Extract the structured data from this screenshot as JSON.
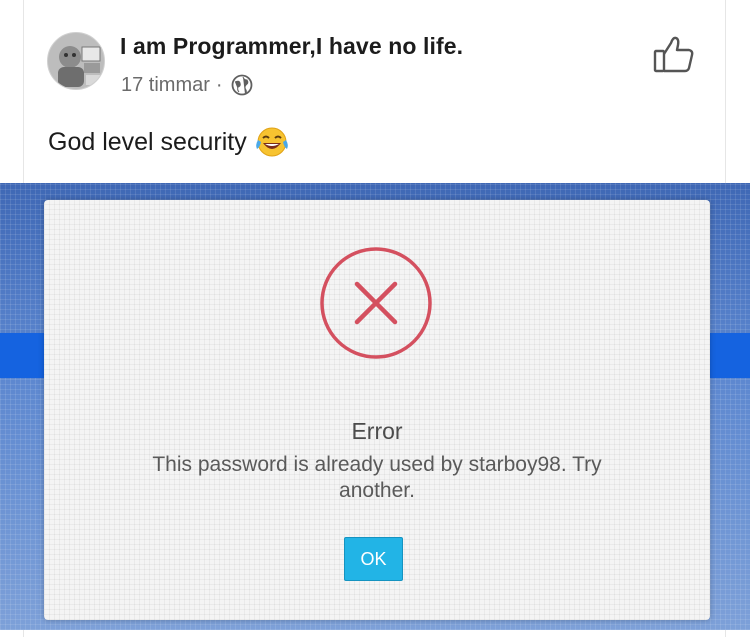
{
  "post": {
    "author": "I am Programmer,I have no life.",
    "time": "17 timmar",
    "separator": "·",
    "text": "God level security",
    "emoji_icon": "face-with-tears-of-joy-icon",
    "privacy_icon": "globe-icon",
    "like_icon": "thumbs-up-icon"
  },
  "dialog": {
    "title": "Error",
    "message": "This password is already used by starboy98. Try another.",
    "ok_label": "OK",
    "icon": "error-x-circle-icon"
  },
  "colors": {
    "error_red": "#d4505f",
    "ok_blue": "#22b4e6",
    "screen_blue": "#1563e0"
  }
}
